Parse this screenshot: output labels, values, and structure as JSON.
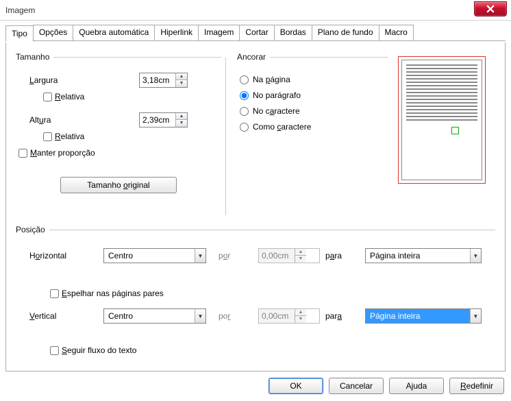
{
  "window": {
    "title": "Imagem"
  },
  "tabs": [
    "Tipo",
    "Opções",
    "Quebra automática",
    "Hiperlink",
    "Imagem",
    "Cortar",
    "Bordas",
    "Plano de fundo",
    "Macro"
  ],
  "active_tab": 0,
  "size": {
    "legend": "Tamanho",
    "width_label": "Largura",
    "width_value": "3,18cm",
    "width_rel_label": "Relativa",
    "width_rel_checked": false,
    "height_label": "Altura",
    "height_value": "2,39cm",
    "height_rel_label": "Relativa",
    "height_rel_checked": false,
    "keep_ratio_label": "Manter proporção",
    "keep_ratio_checked": false,
    "original_btn": "Tamanho original"
  },
  "anchor": {
    "legend": "Ancorar",
    "options": [
      "Na página",
      "No parágrafo",
      "No caractere",
      "Como caractere"
    ],
    "selected": 1
  },
  "position": {
    "legend": "Posição",
    "h_label": "Horizontal",
    "h_value": "Centro",
    "h_by_label": "por",
    "h_by_value": "0,00cm",
    "h_to_label": "para",
    "h_to_value": "Página inteira",
    "mirror_label": "Espelhar nas páginas pares",
    "mirror_checked": false,
    "v_label": "Vertical",
    "v_value": "Centro",
    "v_by_label": "por",
    "v_by_value": "0,00cm",
    "v_to_label": "para",
    "v_to_value": "Página inteira",
    "follow_label": "Seguir fluxo do texto",
    "follow_checked": false
  },
  "buttons": {
    "ok": "OK",
    "cancel": "Cancelar",
    "help": "Ajuda",
    "reset": "Redefinir"
  },
  "underlines": {
    "width": "L",
    "height": "",
    "rel": "R",
    "keep": "M",
    "original": "o",
    "page": "p",
    "para": "g",
    "char": "a",
    "aschar": "c",
    "hor": "o",
    "mirror": "E",
    "ver": "V",
    "follow": "S",
    "by": "o",
    "to": "a",
    "help": "j",
    "reset": "R"
  }
}
